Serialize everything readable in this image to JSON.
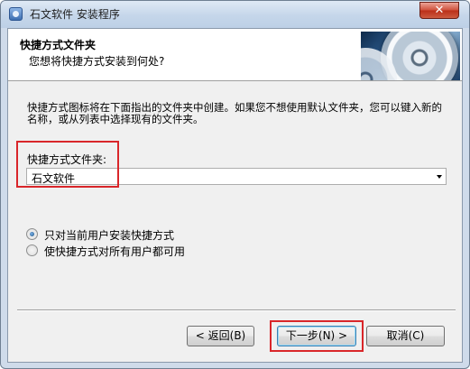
{
  "window": {
    "title": "石文软件 安装程序",
    "close_glyph": "✕"
  },
  "header": {
    "title": "快捷方式文件夹",
    "subtitle": "您想将快捷方式安装到何处?"
  },
  "main": {
    "description": "快捷方式图标将在下面指出的文件夹中创建。如果您不想使用默认文件夹，您可以键入新的名称，或从列表中选择现有的文件夹。",
    "folder_label": "快捷方式文件夹:",
    "folder_value": "石文软件",
    "options": [
      {
        "label": "只对当前用户安装快捷方式",
        "selected": true
      },
      {
        "label": "使快捷方式对所有用户都可用",
        "selected": false
      }
    ]
  },
  "buttons": {
    "back": "< 返回(B)",
    "next": "下一步(N) >",
    "cancel": "取消(C)"
  },
  "colors": {
    "highlight": "#d9262a",
    "close_button": "#c8412b"
  }
}
